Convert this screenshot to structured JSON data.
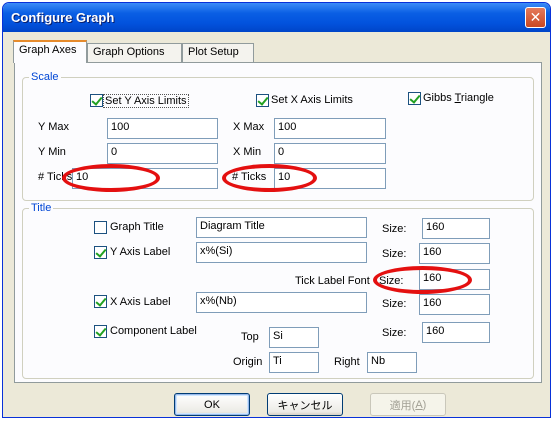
{
  "window": {
    "title": "Configure Graph",
    "close_glyph": "✕"
  },
  "tabs": [
    "Graph Axes",
    "Graph Options",
    "Plot Setup"
  ],
  "scale": {
    "legend": "Scale",
    "set_y_limits": "Set Y Axis Limits",
    "set_x_limits": "Set X Axis Limits",
    "gibbs_pre": "Gibbs ",
    "gibbs_ul": "T",
    "gibbs_post": "riangle",
    "y_max_label": "Y Max",
    "y_max_value": "100",
    "x_max_label": "X Max",
    "x_max_value": "100",
    "y_min_label": "Y Min",
    "y_min_value": "0",
    "x_min_label": "X Min",
    "x_min_value": "0",
    "y_ticks_label": "# Ticks",
    "y_ticks_value": "10",
    "x_ticks_label": "# Ticks",
    "x_ticks_value": "10"
  },
  "title_group": {
    "legend": "Title",
    "graph_title_label": "Graph Title",
    "graph_title_value": "Diagram Title",
    "graph_title_size_label": "Size:",
    "graph_title_size": "160",
    "y_axis_label": "Y Axis Label",
    "y_axis_value": "x%(Si)",
    "y_axis_size_label": "Size:",
    "y_axis_size": "160",
    "tick_font_label": "Tick Label Font",
    "tick_size_label": "Size:",
    "tick_size": "160",
    "x_axis_label": "X Axis Label",
    "x_axis_value": "x%(Nb)",
    "x_axis_size_label": "Size:",
    "x_axis_size": "160",
    "component_label": "Component Label",
    "component_size_label": "Size:",
    "component_size": "160",
    "top_label": "Top",
    "top_value": "Si",
    "origin_label": "Origin",
    "origin_value": "Ti",
    "right_label": "Right",
    "right_value": "Nb"
  },
  "buttons": {
    "ok": "OK",
    "cancel": "キャンセル",
    "apply_pre": "適用(",
    "apply_ul": "A",
    "apply_post": ")"
  },
  "colors": {
    "annotation": "#E41010",
    "titlebar": "#0A5FE4",
    "legend": "#0046D5"
  },
  "checkboxes": {
    "set_y_limits": true,
    "set_x_limits": true,
    "gibbs_triangle": true,
    "graph_title": false,
    "y_axis_label": true,
    "x_axis_label": true,
    "component_label": true
  }
}
